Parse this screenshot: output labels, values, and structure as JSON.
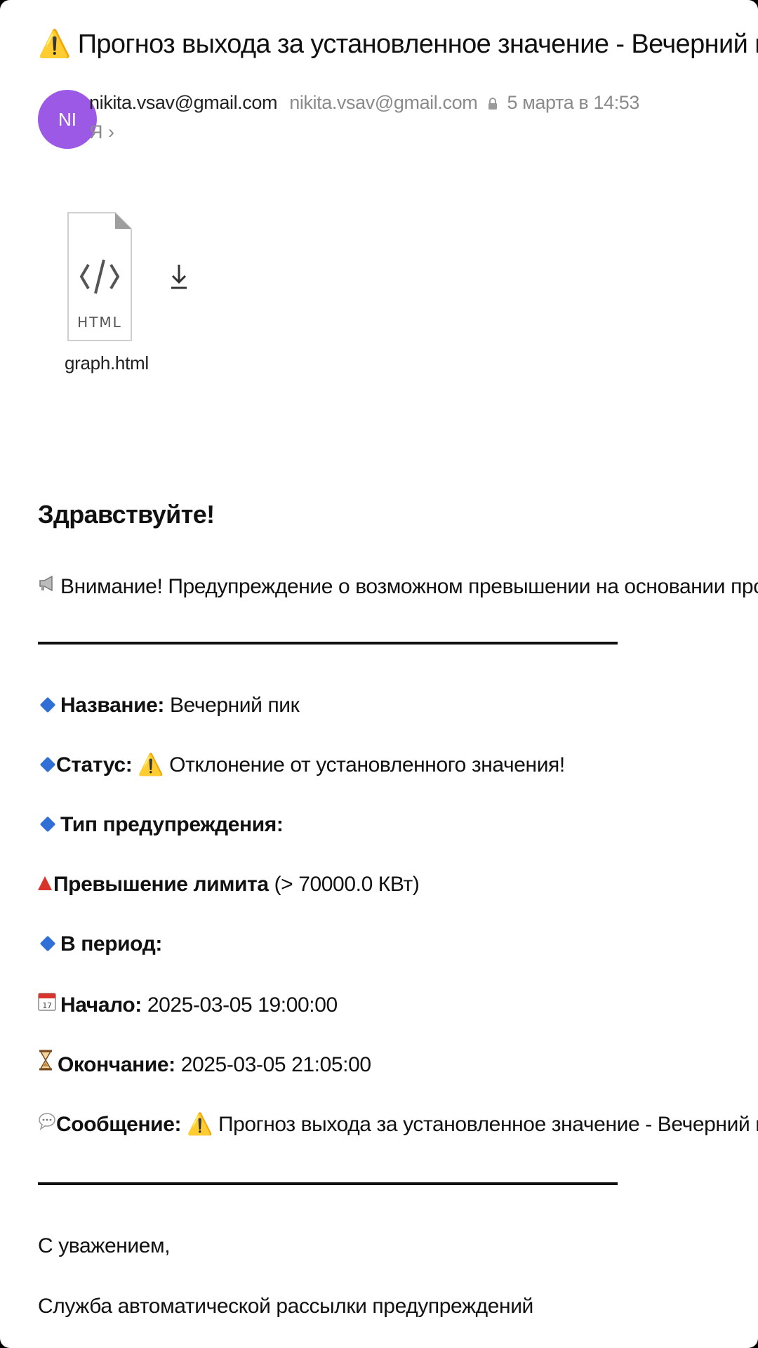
{
  "email": {
    "subject": "Прогноз выхода за установленное значение - Вечерний пик",
    "sender": {
      "avatar_initials": "NI",
      "name": "nikita.vsav@gmail.com",
      "address": "nikita.vsav@gmail.com",
      "date": "5 марта в 14:53",
      "recipient": "Я ›"
    },
    "attachment": {
      "type_label": "HTML",
      "filename": "graph.html"
    }
  },
  "body": {
    "greeting": "Здравствуйте!",
    "alert": "Внимание! Предупреждение о возможном превышении на основании прогноза",
    "fields": {
      "name_label": "Название:",
      "name_value": "Вечерний пик",
      "status_label": "Статус:",
      "status_value": "Отклонение от установленного значения!",
      "warning_type_label": "Тип предупреждения:",
      "limit_label": "Превышение лимита",
      "limit_value": "(> 70000.0 КВт)",
      "period_label": "В период:",
      "start_label": "Начало:",
      "start_value": "2025-03-05 19:00:00",
      "end_label": "Окончание:",
      "end_value": "2025-03-05 21:05:00",
      "message_label": "Сообщение:",
      "message_value": "Прогноз выхода за установленное значение - Вечерний пик"
    },
    "closing": "С уважением,",
    "signature": "Служба автоматической рассылки предупреждений"
  },
  "colors": {
    "avatar": "#9b59e6",
    "warning": "#e8a900",
    "diamond": "#2f6fd6",
    "triangle": "#d9342b"
  },
  "icons": [
    "warning-icon",
    "lock-icon",
    "html-file-icon",
    "download-icon",
    "megaphone-icon",
    "diamond-icon",
    "red-triangle-icon",
    "calendar-icon",
    "hourglass-icon",
    "speech-bubble-icon"
  ]
}
